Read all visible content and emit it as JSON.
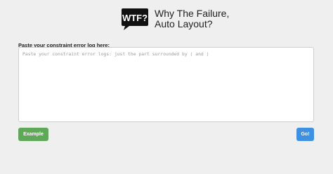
{
  "header": {
    "logo_text": "WTF?",
    "title_line1": "Why The Failure,",
    "title_line2": "Auto Layout?"
  },
  "form": {
    "label": "Paste your constraint error log here:",
    "placeholder": "Paste your constraint error logs: just the part surrounded by ( and )",
    "value": ""
  },
  "buttons": {
    "example_label": "Example",
    "go_label": "Go!"
  },
  "colors": {
    "background": "#efefef",
    "example_button": "#5fa85a",
    "go_button": "#3f90e0"
  }
}
